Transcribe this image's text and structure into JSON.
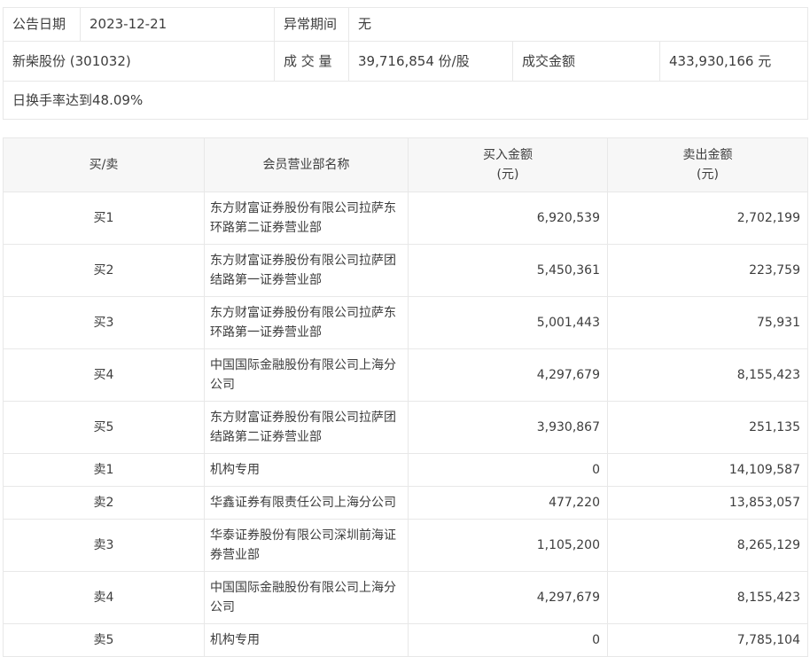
{
  "info": {
    "announce_date_label": "公告日期",
    "announce_date": "2023-12-21",
    "abnormal_period_label": "异常期间",
    "abnormal_period": "无",
    "stock_name": "新柴股份 (301032)",
    "volume_label": "成 交 量",
    "volume": "39,716,854 份/股",
    "turnover_label": "成交金额",
    "turnover": "433,930,166 元",
    "list_reason": "日换手率达到48.09%"
  },
  "table": {
    "headers": {
      "side": "买/卖",
      "branch": "会员营业部名称",
      "buy_line1": "买入金额",
      "buy_line2": "(元)",
      "sell_line1": "卖出金额",
      "sell_line2": "(元)"
    },
    "rows": [
      {
        "side": "买1",
        "branch": "东方财富证券股份有限公司拉萨东环路第二证券营业部",
        "buy": "6,920,539",
        "sell": "2,702,199"
      },
      {
        "side": "买2",
        "branch": "东方财富证券股份有限公司拉萨团结路第一证券营业部",
        "buy": "5,450,361",
        "sell": "223,759"
      },
      {
        "side": "买3",
        "branch": "东方财富证券股份有限公司拉萨东环路第一证券营业部",
        "buy": "5,001,443",
        "sell": "75,931"
      },
      {
        "side": "买4",
        "branch": "中国国际金融股份有限公司上海分公司",
        "buy": "4,297,679",
        "sell": "8,155,423"
      },
      {
        "side": "买5",
        "branch": "东方财富证券股份有限公司拉萨团结路第二证券营业部",
        "buy": "3,930,867",
        "sell": "251,135"
      },
      {
        "side": "卖1",
        "branch": "机构专用",
        "buy": "0",
        "sell": "14,109,587"
      },
      {
        "side": "卖2",
        "branch": "华鑫证券有限责任公司上海分公司",
        "buy": "477,220",
        "sell": "13,853,057"
      },
      {
        "side": "卖3",
        "branch": "华泰证券股份有限公司深圳前海证券营业部",
        "buy": "1,105,200",
        "sell": "8,265,129"
      },
      {
        "side": "卖4",
        "branch": "中国国际金融股份有限公司上海分公司",
        "buy": "4,297,679",
        "sell": "8,155,423"
      },
      {
        "side": "卖5",
        "branch": "机构专用",
        "buy": "0",
        "sell": "7,785,104"
      }
    ]
  },
  "colors": {
    "border": "#e8e8e8",
    "header_bg": "#f7f7f7",
    "text": "#3d3d3d"
  }
}
